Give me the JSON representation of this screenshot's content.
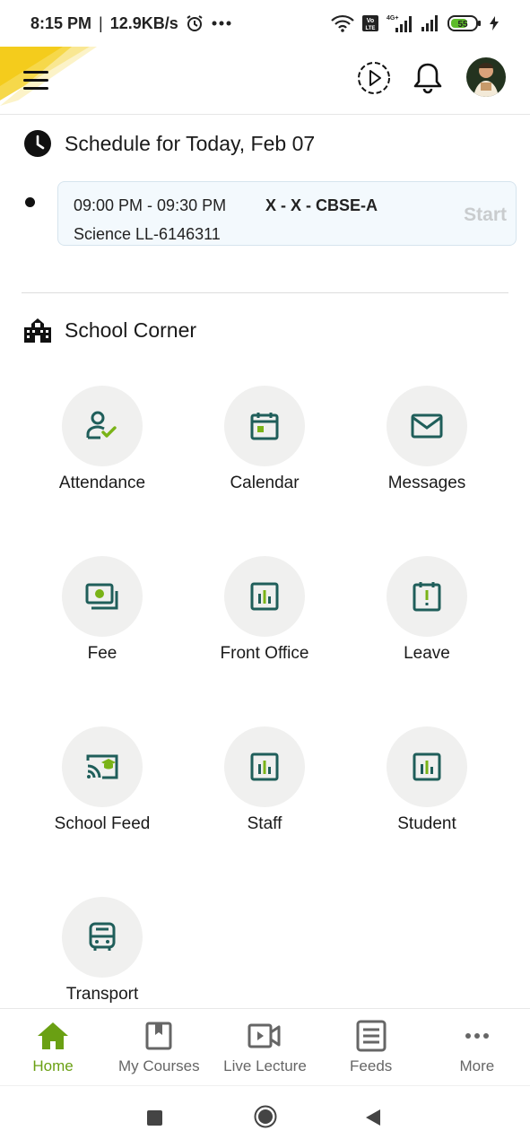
{
  "status_bar": {
    "time": "8:15 PM",
    "net_speed": "12.9KB/s",
    "network_label": "4G+",
    "volte_label": "Vo LTE",
    "battery": "55"
  },
  "header": {
    "menu_icon": "hamburger-icon",
    "play_icon": "play-circle-icon",
    "bell_icon": "bell-icon",
    "avatar": "user-avatar"
  },
  "schedule": {
    "title": "Schedule for Today, Feb 07",
    "classes": [
      {
        "time": "09:00 PM - 09:30 PM",
        "batch": "X - X - CBSE-A",
        "subject": "Science LL-6146311",
        "action": "Start"
      }
    ]
  },
  "school_corner": {
    "title": "School Corner",
    "items": [
      {
        "label": "Attendance",
        "icon": "attendance-icon"
      },
      {
        "label": "Calendar",
        "icon": "calendar-icon"
      },
      {
        "label": "Messages",
        "icon": "mail-icon"
      },
      {
        "label": "Fee",
        "icon": "money-icon"
      },
      {
        "label": "Front Office",
        "icon": "bar-chart-icon"
      },
      {
        "label": "Leave",
        "icon": "alert-calendar-icon"
      },
      {
        "label": "School Feed",
        "icon": "cast-graduation-icon"
      },
      {
        "label": "Staff",
        "icon": "bar-chart-icon"
      },
      {
        "label": "Student",
        "icon": "bar-chart-icon"
      },
      {
        "label": "Transport",
        "icon": "bus-icon"
      }
    ]
  },
  "bottom_nav": {
    "items": [
      {
        "label": "Home",
        "icon": "home-icon",
        "active": true
      },
      {
        "label": "My Courses",
        "icon": "bookmark-book-icon",
        "active": false
      },
      {
        "label": "Live Lecture",
        "icon": "video-camera-icon",
        "active": false
      },
      {
        "label": "Feeds",
        "icon": "feed-list-icon",
        "active": false
      },
      {
        "label": "More",
        "icon": "more-dots-icon",
        "active": false
      }
    ]
  },
  "colors": {
    "accent_green": "#6aa013",
    "icon_teal": "#1f5e5a",
    "icon_green": "#7ab317",
    "tile_bg": "#f0f0ef"
  }
}
